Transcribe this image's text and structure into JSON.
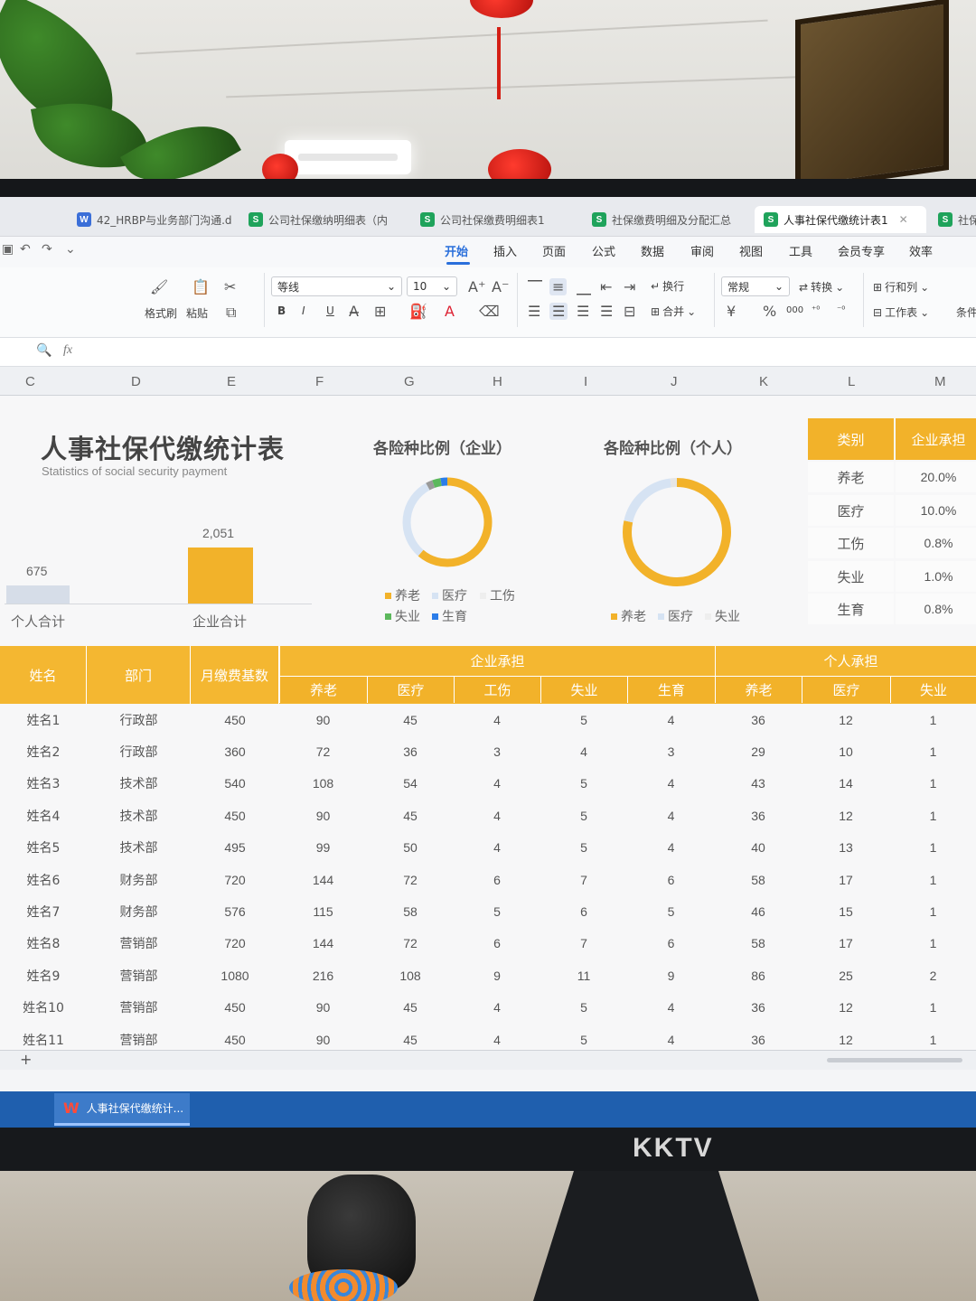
{
  "tabs": [
    {
      "badge": "W",
      "badge_color": "#3b6fd8",
      "label": "42_HRBP与业务部门沟通.d"
    },
    {
      "badge": "S",
      "badge_color": "#1fa35b",
      "label": "公司社保缴纳明细表（内"
    },
    {
      "badge": "S",
      "badge_color": "#1fa35b",
      "label": "公司社保缴费明细表1"
    },
    {
      "badge": "S",
      "badge_color": "#1fa35b",
      "label": "社保缴费明细及分配汇总"
    },
    {
      "badge": "S",
      "badge_color": "#1fa35b",
      "label": "人事社保代缴统计表1"
    },
    {
      "badge": "S",
      "badge_color": "#1fa35b",
      "label": "社保"
    }
  ],
  "menu": [
    "开始",
    "插入",
    "页面",
    "公式",
    "数据",
    "审阅",
    "视图",
    "工具",
    "会员专享",
    "效率"
  ],
  "ribbon": {
    "format_painter": "格式刷",
    "paste": "粘贴",
    "font_name": "等线",
    "font_size": "10",
    "wrap": "换行",
    "merge": "合并",
    "number_format": "常规",
    "convert": "转换",
    "row_col": "行和列",
    "worksheet": "工作表",
    "conditional": "条件",
    "currency": "¥",
    "percent": "%",
    "bold": "B",
    "italic": "I",
    "underline": "U"
  },
  "formula_bar": {
    "fx": "fx"
  },
  "columns": [
    "C",
    "D",
    "E",
    "F",
    "G",
    "H",
    "I",
    "J",
    "K",
    "L",
    "M"
  ],
  "report": {
    "title": "人事社保代缴统计表",
    "subtitle": "Statistics of social security payment"
  },
  "totals_chart": {
    "chart_data": {
      "type": "bar",
      "categories": [
        "个人合计",
        "企业合计"
      ],
      "values": [
        675,
        2051
      ],
      "value_labels": [
        "675",
        "2,051"
      ],
      "colors": [
        "#d6dde8",
        "#f2b22a"
      ]
    }
  },
  "donut_company": {
    "title": "各险种比例（企业）",
    "chart_data": {
      "type": "pie",
      "categories": [
        "养老",
        "医疗",
        "工伤",
        "失业",
        "生育"
      ],
      "values": [
        20.0,
        10.0,
        0.8,
        1.0,
        0.8
      ],
      "colors": [
        "#f2b22a",
        "#d6e3f3",
        "#9a9a9a",
        "#5cb85c",
        "#2b7de9"
      ]
    }
  },
  "donut_personal": {
    "title": "各险种比例（个人）",
    "chart_data": {
      "type": "pie",
      "categories": [
        "养老",
        "医疗",
        "失业"
      ],
      "values": [
        8,
        2,
        0.2
      ],
      "colors": [
        "#f2b22a",
        "#d6e3f3",
        "#e6e6e6"
      ]
    }
  },
  "rates": {
    "header": [
      "类别",
      "企业承担"
    ],
    "rows": [
      {
        "type": "养老",
        "rate": "20.0%"
      },
      {
        "type": "医疗",
        "rate": "10.0%"
      },
      {
        "type": "工伤",
        "rate": "0.8%"
      },
      {
        "type": "失业",
        "rate": "1.0%"
      },
      {
        "type": "生育",
        "rate": "0.8%"
      }
    ]
  },
  "grid": {
    "h_name": "姓名",
    "h_dept": "部门",
    "h_base": "月缴费基数",
    "h_company": "企业承担",
    "h_personal": "个人承担",
    "company_sub": [
      "养老",
      "医疗",
      "工伤",
      "失业",
      "生育"
    ],
    "personal_sub": [
      "养老",
      "医疗",
      "失业"
    ],
    "rows": [
      [
        "姓名1",
        "行政部",
        "450",
        "90",
        "45",
        "4",
        "5",
        "4",
        "36",
        "12",
        "1"
      ],
      [
        "姓名2",
        "行政部",
        "360",
        "72",
        "36",
        "3",
        "4",
        "3",
        "29",
        "10",
        "1"
      ],
      [
        "姓名3",
        "技术部",
        "540",
        "108",
        "54",
        "4",
        "5",
        "4",
        "43",
        "14",
        "1"
      ],
      [
        "姓名4",
        "技术部",
        "450",
        "90",
        "45",
        "4",
        "5",
        "4",
        "36",
        "12",
        "1"
      ],
      [
        "姓名5",
        "技术部",
        "495",
        "99",
        "50",
        "4",
        "5",
        "4",
        "40",
        "13",
        "1"
      ],
      [
        "姓名6",
        "财务部",
        "720",
        "144",
        "72",
        "6",
        "7",
        "6",
        "58",
        "17",
        "1"
      ],
      [
        "姓名7",
        "财务部",
        "576",
        "115",
        "58",
        "5",
        "6",
        "5",
        "46",
        "15",
        "1"
      ],
      [
        "姓名8",
        "营销部",
        "720",
        "144",
        "72",
        "6",
        "7",
        "6",
        "58",
        "17",
        "1"
      ],
      [
        "姓名9",
        "营销部",
        "1080",
        "216",
        "108",
        "9",
        "11",
        "9",
        "86",
        "25",
        "2"
      ],
      [
        "姓名10",
        "营销部",
        "450",
        "90",
        "45",
        "4",
        "5",
        "4",
        "36",
        "12",
        "1"
      ],
      [
        "姓名11",
        "营销部",
        "450",
        "90",
        "45",
        "4",
        "5",
        "4",
        "36",
        "12",
        "1"
      ]
    ]
  },
  "sheet_tabs": {
    "add": "+"
  },
  "taskbar": {
    "label": "人事社保代缴统计..."
  },
  "monitor": {
    "brand": "KKTV"
  }
}
